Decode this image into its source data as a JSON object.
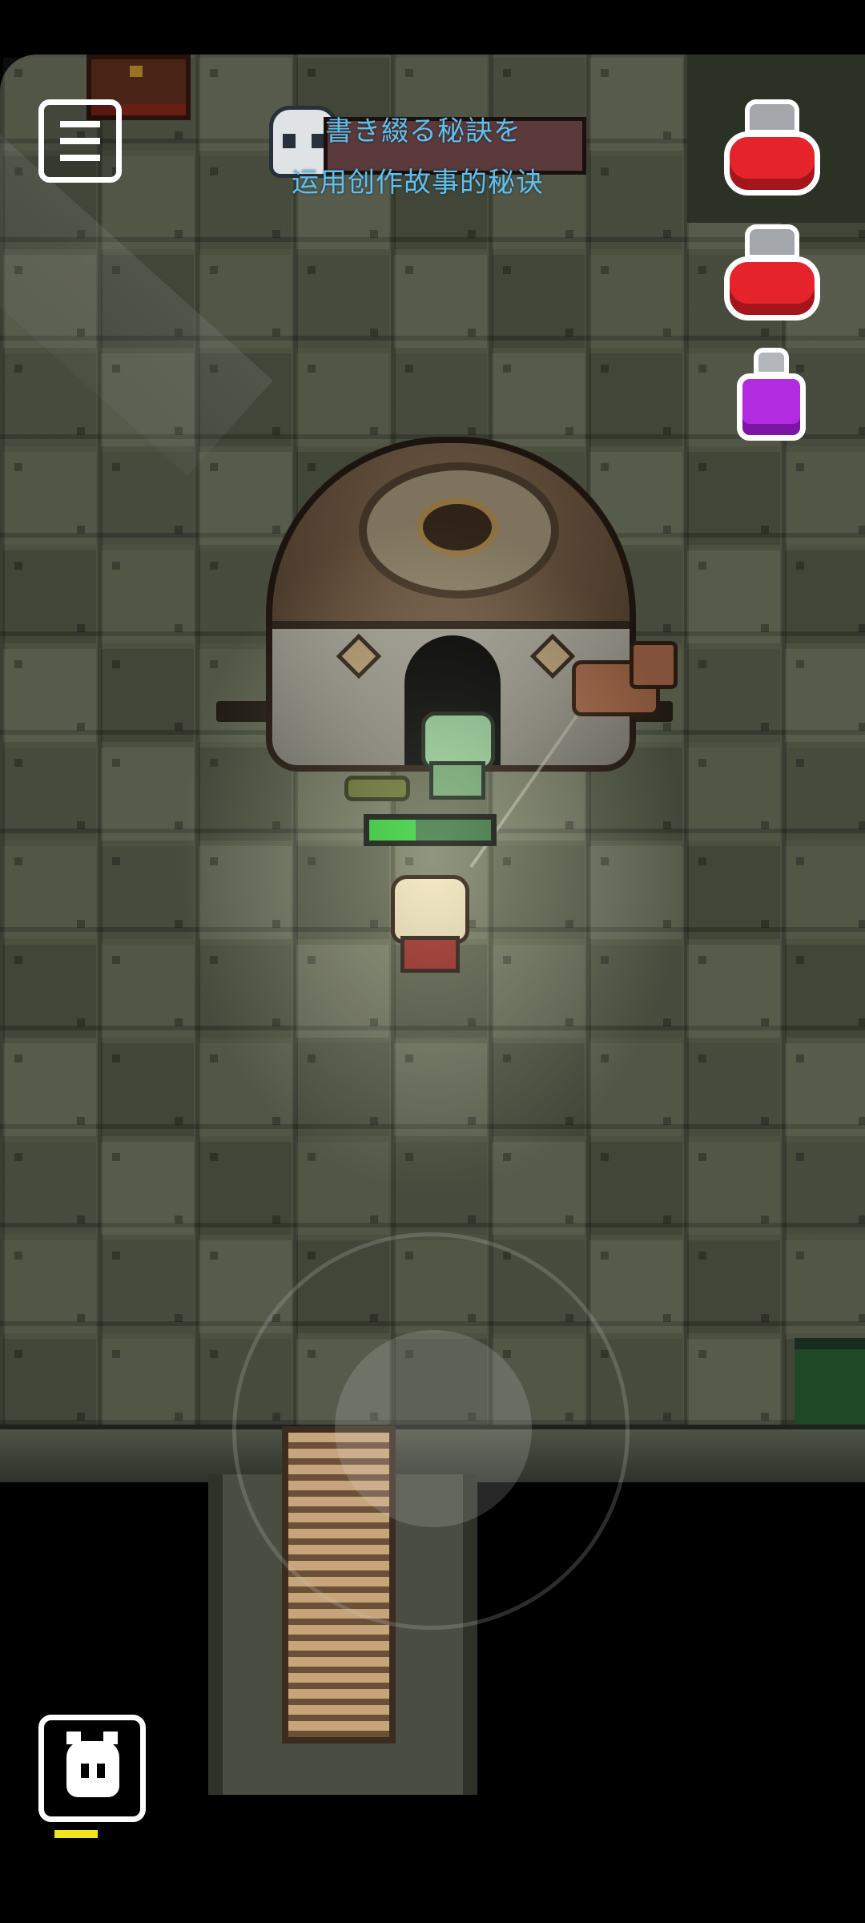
{
  "hud": {
    "menu": {
      "icon": "hamburger-menu-icon"
    },
    "quest": {
      "icon": "skull-icon",
      "line1": "書き綴る秘訣を",
      "line2": "运用创作故事的秘诀"
    },
    "potions": [
      {
        "icon": "red-health-potion-icon",
        "color": "#e5232a"
      },
      {
        "icon": "red-health-potion-icon",
        "color": "#e5232a"
      },
      {
        "icon": "purple-mana-potion-icon",
        "color": "#b22be0"
      }
    ],
    "pet_button": {
      "icon": "pet-face-icon",
      "cooldown_color": "#f4e21a"
    },
    "joystick": {
      "icon": "virtual-joystick"
    }
  },
  "world": {
    "enemy_health": {
      "fraction": 0.38,
      "fill_color": "#36d43f"
    },
    "entities": [
      "zombie-enemy",
      "player-character",
      "pet-dog",
      "bunker",
      "treasure-chest",
      "ladder",
      "dropped-glasses"
    ]
  }
}
